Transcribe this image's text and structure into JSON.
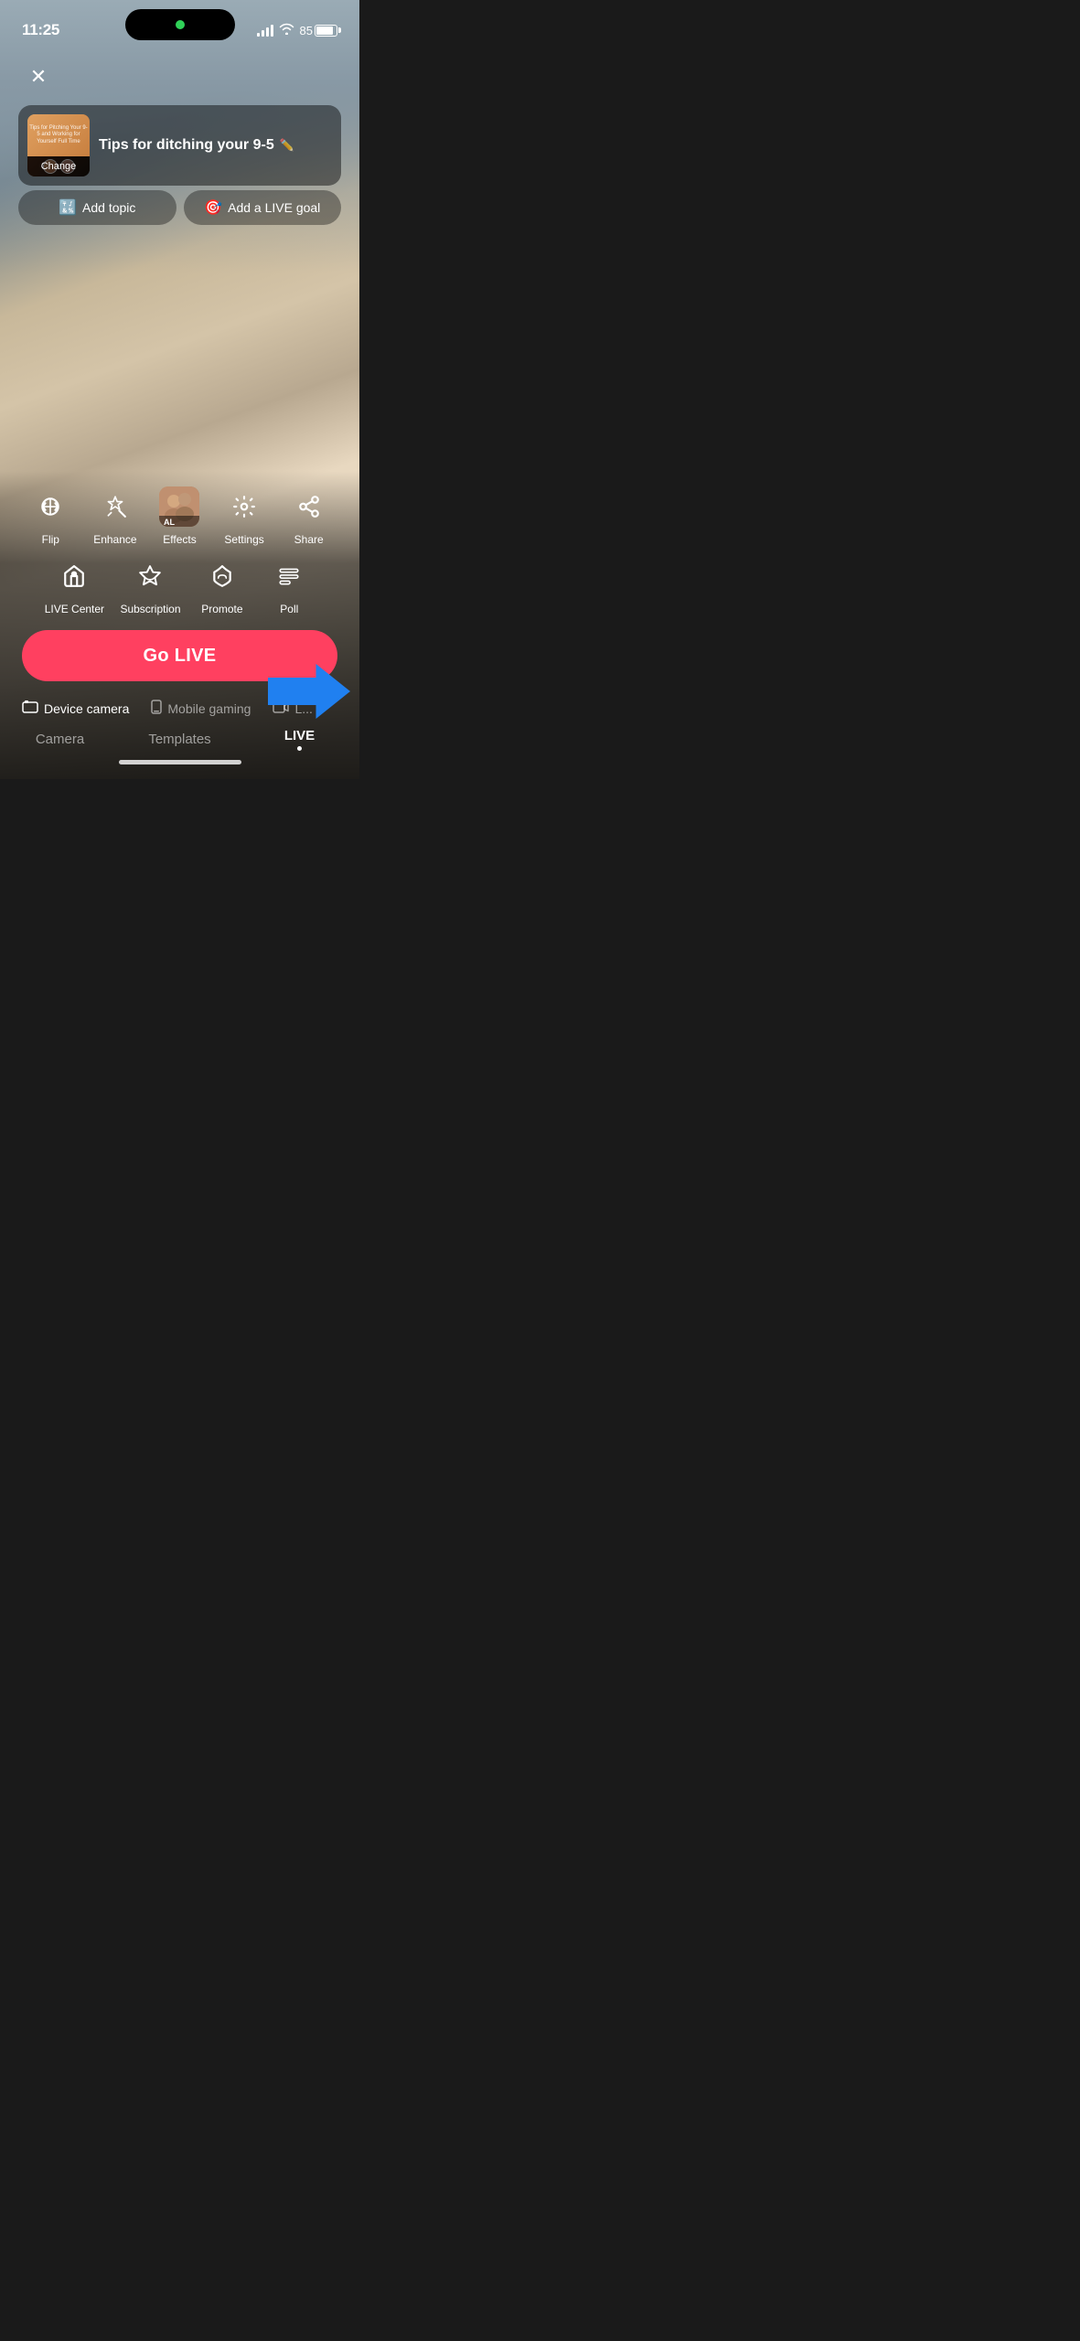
{
  "statusBar": {
    "time": "11:25",
    "battery": "85"
  },
  "closeButton": "✕",
  "titleCard": {
    "title": "Tips for ditching your 9-5",
    "changeLabel": "Change",
    "thumbnailText": "Tips for Pitching Your 9-5 and Working for Yourself Full Time"
  },
  "topicRow": {
    "topicIcon": "🔣",
    "topicLabel": "Add topic",
    "goalIcon": "🎯",
    "goalLabel": "Add a LIVE goal"
  },
  "tools": {
    "row1": [
      {
        "id": "flip",
        "label": "Flip",
        "icon": "flip"
      },
      {
        "id": "enhance",
        "label": "Enhance",
        "icon": "enhance"
      },
      {
        "id": "effects",
        "label": "Effects",
        "icon": "effects"
      },
      {
        "id": "settings",
        "label": "Settings",
        "icon": "settings"
      },
      {
        "id": "share",
        "label": "Share",
        "icon": "share"
      }
    ],
    "row2": [
      {
        "id": "live-center",
        "label": "LIVE Center",
        "icon": "live-center"
      },
      {
        "id": "subscription",
        "label": "Subscription",
        "icon": "subscription"
      },
      {
        "id": "promote",
        "label": "Promote",
        "icon": "promote"
      },
      {
        "id": "poll",
        "label": "Poll",
        "icon": "poll"
      }
    ]
  },
  "goLiveButton": "Go LIVE",
  "cameraOptions": [
    {
      "id": "device-camera",
      "icon": "📷",
      "label": "Device camera",
      "active": true
    },
    {
      "id": "mobile-gaming",
      "icon": "📱",
      "label": "Mobile gaming",
      "active": false
    },
    {
      "id": "live-extra",
      "icon": "📹",
      "label": "L...",
      "active": false
    }
  ],
  "tabs": [
    {
      "id": "camera",
      "label": "Camera",
      "active": false
    },
    {
      "id": "templates",
      "label": "Templates",
      "active": false
    },
    {
      "id": "live",
      "label": "LIVE",
      "active": true
    }
  ]
}
